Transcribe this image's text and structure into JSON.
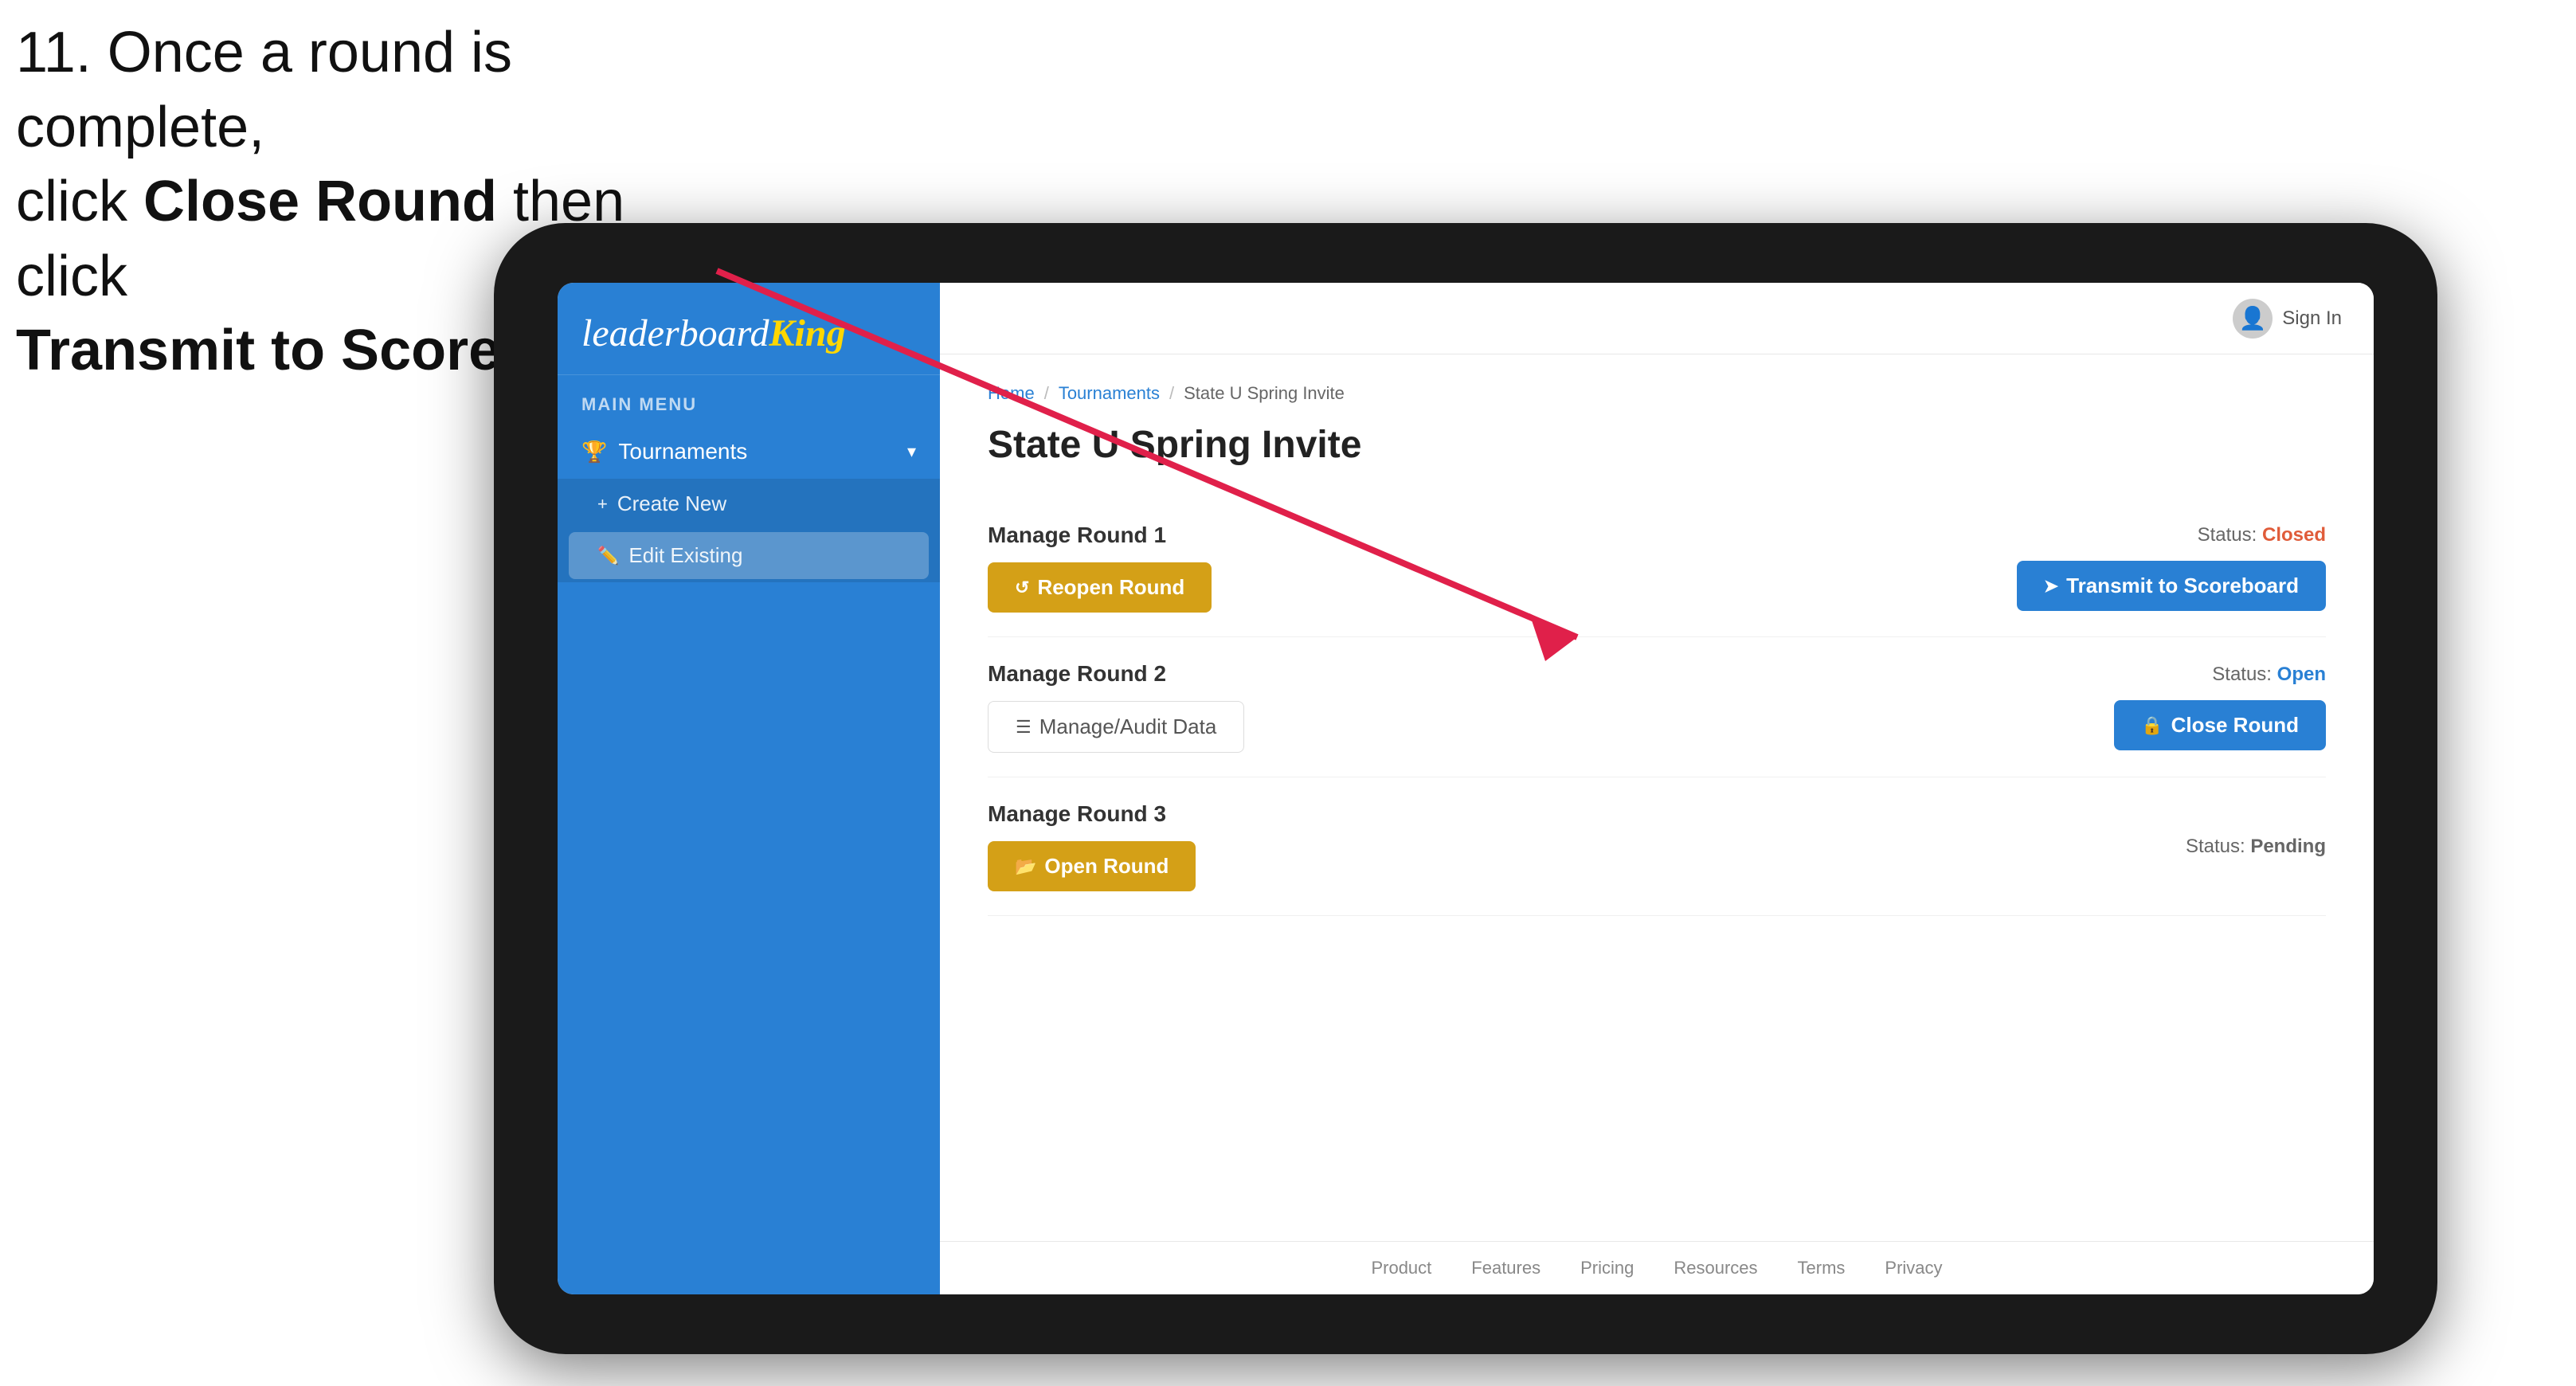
{
  "instruction": {
    "line1": "11. Once a round is complete,",
    "line2_prefix": "click ",
    "line2_bold": "Close Round",
    "line2_suffix": " then click",
    "line3": "Transmit to Scoreboard."
  },
  "app": {
    "logo": {
      "leaderboard": "leaderboard",
      "king": "King"
    },
    "sidebar": {
      "menu_label": "MAIN MENU",
      "items": [
        {
          "label": "Tournaments",
          "icon": "🏆",
          "chevron": "▾",
          "sub_items": [
            {
              "label": "Create New",
              "icon": "+"
            },
            {
              "label": "Edit Existing",
              "icon": "✏️"
            }
          ]
        }
      ]
    },
    "topbar": {
      "sign_in": "Sign In",
      "avatar_icon": "👤"
    },
    "breadcrumb": {
      "home": "Home",
      "sep1": "/",
      "tournaments": "Tournaments",
      "sep2": "/",
      "current": "State U Spring Invite"
    },
    "page_title": "State U Spring Invite",
    "rounds": [
      {
        "title": "Manage Round 1",
        "status_label": "Status:",
        "status_value": "Closed",
        "status_type": "closed",
        "buttons": [
          {
            "label": "Reopen Round",
            "icon": "↺",
            "type": "gold"
          },
          {
            "label": "Transmit to Scoreboard",
            "icon": "➤",
            "type": "blue"
          }
        ]
      },
      {
        "title": "Manage Round 2",
        "status_label": "Status:",
        "status_value": "Open",
        "status_type": "open",
        "buttons": [
          {
            "label": "Manage/Audit Data",
            "icon": "☰",
            "type": "outline"
          },
          {
            "label": "Close Round",
            "icon": "🔒",
            "type": "blue"
          }
        ]
      },
      {
        "title": "Manage Round 3",
        "status_label": "Status:",
        "status_value": "Pending",
        "status_type": "pending",
        "buttons": [
          {
            "label": "Open Round",
            "icon": "📂",
            "type": "gold"
          }
        ]
      }
    ],
    "footer": {
      "links": [
        "Product",
        "Features",
        "Pricing",
        "Resources",
        "Terms",
        "Privacy"
      ]
    }
  }
}
